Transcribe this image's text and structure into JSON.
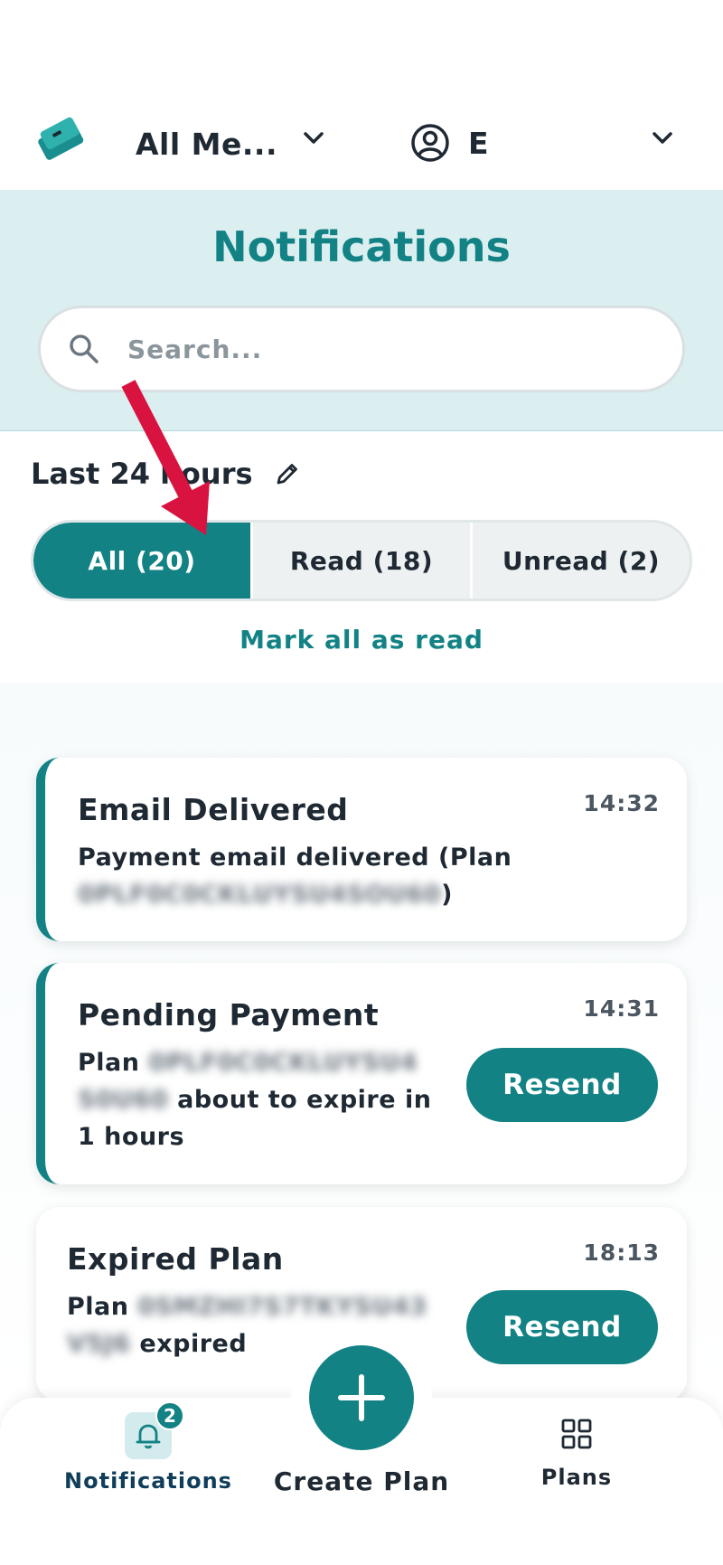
{
  "header": {
    "merchant_label": "All Me...",
    "user_label": "E"
  },
  "banner": {
    "title": "Notifications",
    "search_placeholder": "Search..."
  },
  "filters": {
    "range_label": "Last 24 hours",
    "tabs": [
      {
        "label": "All (20)",
        "active": true
      },
      {
        "label": "Read (18)",
        "active": false
      },
      {
        "label": "Unread (2)",
        "active": false
      }
    ],
    "mark_all_label": "Mark all as read"
  },
  "notifications": [
    {
      "title": "Email Delivered",
      "time": "14:32",
      "text_before": "Payment email delivered (Plan ",
      "redacted": "0PLF0C0CKLUYSU4SOU60",
      "text_after": ")",
      "unread": true
    },
    {
      "title": "Pending Payment",
      "time": "14:31",
      "text_before": "Plan ",
      "redacted": "0PLF0C0CKLUYSU4 S0U60",
      "text_after": " about to expire in 1 hours",
      "action_label": "Resend",
      "unread": true
    },
    {
      "title": "Expired Plan",
      "time": "18:13",
      "text_before": "Plan ",
      "redacted": "0SMZHI7S7TKYSU43 V5J6",
      "text_after": " expired",
      "action_label": "Resend",
      "unread": false
    }
  ],
  "bottom_nav": {
    "notifications_label": "Notifications",
    "notifications_badge": "2",
    "create_label": "Create Plan",
    "plans_label": "Plans"
  },
  "colors": {
    "accent": "#128285",
    "banner_bg": "#dbeef0",
    "annotation_arrow": "#d9133f"
  },
  "icons": {
    "logo": "ticket-logo-icon",
    "merchant_chevron": "chevron-down-icon",
    "user": "user-circle-icon",
    "user_chevron": "chevron-down-icon",
    "search": "search-icon",
    "edit": "pencil-icon",
    "nav_notifications": "bell-icon",
    "nav_create": "plus-icon",
    "nav_plans": "grid-icon"
  }
}
